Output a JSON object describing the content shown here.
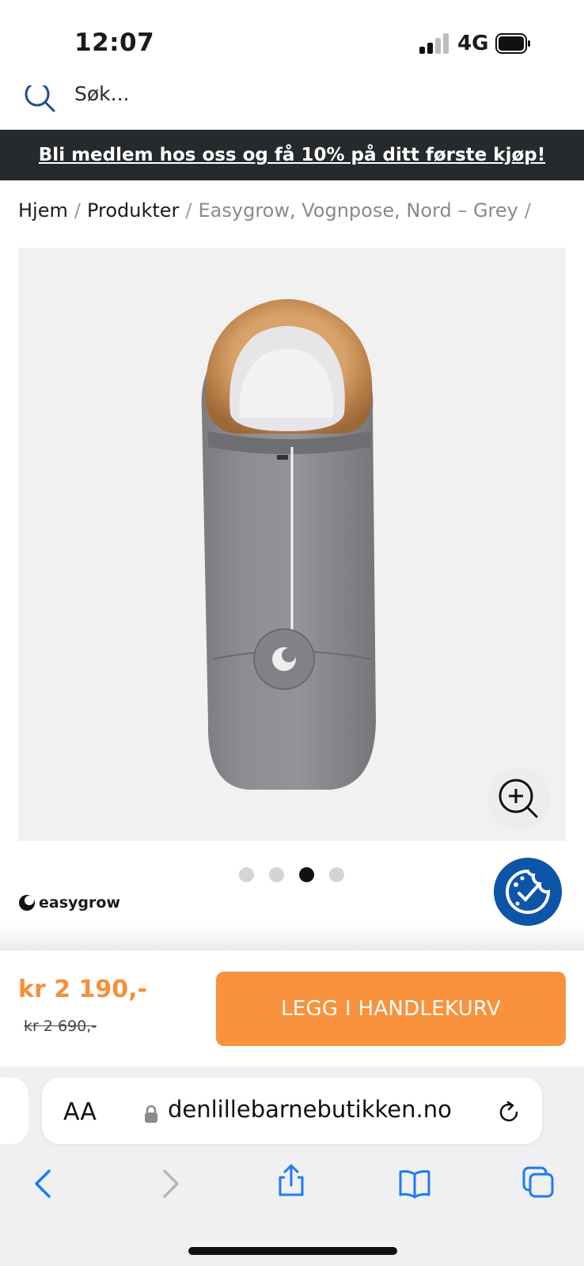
{
  "status_bar": {
    "time": "12:07",
    "network": "4G",
    "signal_icon": "signal-bars-icon",
    "battery_icon": "battery-icon"
  },
  "search": {
    "placeholder": "Søk..."
  },
  "promo": {
    "text": "Bli medlem hos oss og få 10% på ditt første kjøp!"
  },
  "breadcrumb": {
    "home": "Hjem",
    "products": "Produkter",
    "current": "Easygrow, Vognpose, Nord – Grey",
    "separator": "/"
  },
  "gallery": {
    "slide_count": 4,
    "active_slide": 3,
    "zoom_icon": "zoom-in-icon"
  },
  "brand": {
    "name": "easygrow"
  },
  "purchase": {
    "price": "kr 2 190,-",
    "old_price": "kr 2 690,-",
    "add_to_cart": "LEGG I HANDLEKURV"
  },
  "browser": {
    "text_size": "AA",
    "domain": "denlillebarnebutikken.no"
  },
  "colors": {
    "accent": "#f9923c",
    "price": "#f4903b",
    "banner": "#262a2d",
    "badge": "#0d55a8",
    "ios_blue": "#1a7cf5"
  }
}
